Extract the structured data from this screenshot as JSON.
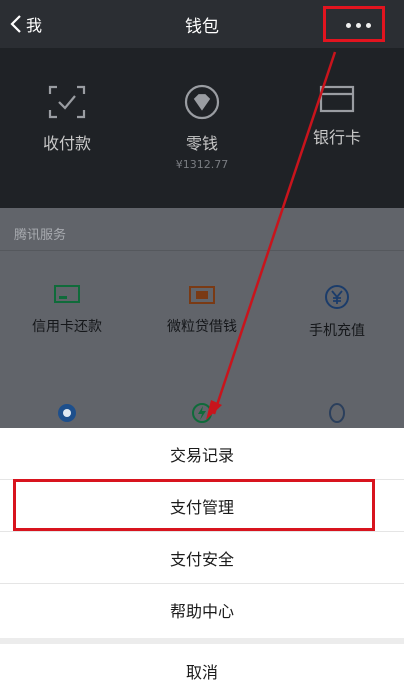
{
  "nav": {
    "back_label": "我",
    "title": "钱包"
  },
  "wallet": {
    "items": [
      {
        "label": "收付款",
        "sub": ""
      },
      {
        "label": "零钱",
        "sub": "¥1312.77"
      },
      {
        "label": "银行卡",
        "sub": ""
      }
    ]
  },
  "services": {
    "section_title": "腾讯服务",
    "items": [
      {
        "label": "信用卡还款"
      },
      {
        "label": "微粒贷借钱"
      },
      {
        "label": "手机充值"
      }
    ]
  },
  "sheet": {
    "items": [
      {
        "label": "交易记录"
      },
      {
        "label": "支付管理"
      },
      {
        "label": "支付安全"
      },
      {
        "label": "帮助中心"
      }
    ],
    "cancel_label": "取消"
  },
  "colors": {
    "highlight": "#d8141e",
    "arrow": "#c8141c",
    "service_icon_green": "#1aad19",
    "service_icon_orange": "#c9661e",
    "service_icon_blue": "#2a7bd6"
  },
  "icons": [
    "chevron-left-icon",
    "more-dots-icon",
    "scan-pay-icon",
    "coin-icon",
    "bank-card-icon",
    "credit-card-icon",
    "loan-icon",
    "yuan-icon"
  ]
}
